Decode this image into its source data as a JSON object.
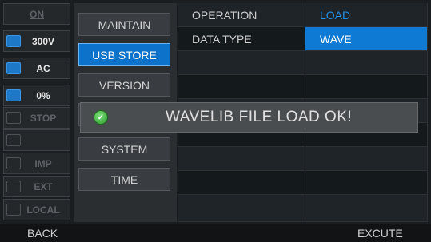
{
  "status": {
    "on": "ON",
    "voltage": "300V",
    "ac": "AC",
    "percent": "0%",
    "stop": "STOP",
    "imp": "IMP",
    "ext": "EXT",
    "local": "LOCAL"
  },
  "menu": {
    "maintain": "MAINTAIN",
    "usb_store": "USB STORE",
    "version": "VERSION",
    "system": "SYSTEM",
    "time": "TIME"
  },
  "table": {
    "rows": [
      {
        "label": "OPERATION",
        "value": "LOAD"
      },
      {
        "label": "DATA TYPE",
        "value": "WAVE"
      }
    ]
  },
  "popup": {
    "message": "WAVELIB FILE LOAD OK!"
  },
  "footer": {
    "back": "BACK",
    "execute": "EXCUTE"
  },
  "colors": {
    "accent": "#0f7ad4",
    "value_text": "#1f8fe8",
    "ok_green": "#3fae3f"
  }
}
